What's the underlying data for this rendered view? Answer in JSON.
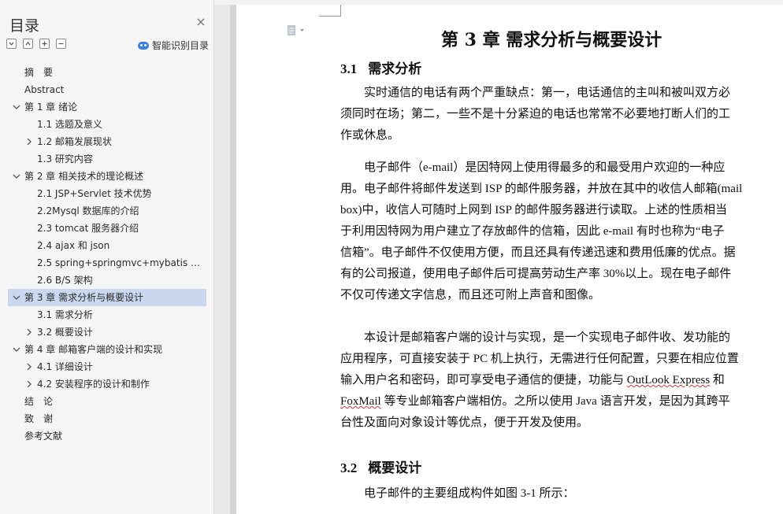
{
  "sidebar": {
    "title": "目录",
    "close": "×",
    "smart_toc_label": "智能识别目录",
    "items": [
      {
        "label": "摘　要",
        "level": 1,
        "arrow": "",
        "selected": false
      },
      {
        "label": "Abstract",
        "level": 1,
        "arrow": "",
        "selected": false
      },
      {
        "label": "第 1 章  绪论",
        "level": 1,
        "arrow": "down",
        "selected": false
      },
      {
        "label": "1.1  选题及意义",
        "level": 2,
        "arrow": "",
        "selected": false
      },
      {
        "label": "1.2  邮箱发展现状",
        "level": 2,
        "arrow": "right",
        "selected": false
      },
      {
        "label": "1.3 研究内容",
        "level": 2,
        "arrow": "",
        "selected": false
      },
      {
        "label": "第 2 章  相关技术的理论概述",
        "level": 1,
        "arrow": "down",
        "selected": false
      },
      {
        "label": "2.1 JSP+Servlet 技术优势",
        "level": 2,
        "arrow": "",
        "selected": false
      },
      {
        "label": "2.2Mysql 数据库的介绍",
        "level": 2,
        "arrow": "",
        "selected": false
      },
      {
        "label": "2.3 tomcat 服务器介绍",
        "level": 2,
        "arrow": "",
        "selected": false
      },
      {
        "label": "2.4 ajax 和 json",
        "level": 2,
        "arrow": "",
        "selected": false
      },
      {
        "label": "2.5 spring+springmvc+mybatis 框...",
        "level": 2,
        "arrow": "",
        "selected": false
      },
      {
        "label": "2.6 B/S 架构",
        "level": 2,
        "arrow": "",
        "selected": false
      },
      {
        "label": "第 3 章  需求分析与概要设计",
        "level": 1,
        "arrow": "down",
        "selected": true
      },
      {
        "label": "3.1  需求分析",
        "level": 2,
        "arrow": "",
        "selected": false
      },
      {
        "label": "3.2  概要设计",
        "level": 2,
        "arrow": "right",
        "selected": false
      },
      {
        "label": "第 4 章  邮箱客户端的设计和实现",
        "level": 1,
        "arrow": "down",
        "selected": false
      },
      {
        "label": "4.1  详细设计",
        "level": 2,
        "arrow": "right",
        "selected": false
      },
      {
        "label": "4.2  安装程序的设计和制作",
        "level": 2,
        "arrow": "right",
        "selected": false
      },
      {
        "label": "结　论",
        "level": 1,
        "arrow": "",
        "selected": false
      },
      {
        "label": "致　谢",
        "level": 1,
        "arrow": "",
        "selected": false
      },
      {
        "label": "参考文献",
        "level": 1,
        "arrow": "",
        "selected": false
      }
    ]
  },
  "document": {
    "chapter_title": "第 3 章  需求分析与概要设计",
    "section1": {
      "num": "3.1",
      "title": "需求分析"
    },
    "para1": [
      "　　实时通信的电话有两个严重缺点：第一，电话通信的主叫和被叫双方必",
      "须同时在场；第二，一些不是十分紧迫的电话也常常不必要地打断人们的工",
      "作或休息。"
    ],
    "para2": [
      "　　电子邮件（e-mail）是因特网上使用得最多的和最受用户欢迎的一种应",
      "用。电子邮件将邮件发送到 ISP 的邮件服务器，并放在其中的收信人邮箱(mail",
      "box)中，收信人可随时上网到 ISP 的邮件服务器进行读取。上述的性质相当",
      "于利用因特网为用户建立了存放邮件的信箱，因此 e-mail 有时也称为“电子",
      "信箱”。电子邮件不仅使用方便，而且还具有传递迅速和费用低廉的优点。据",
      "有的公司报道，使用电子邮件后可提高劳动生产率 30%以上。现在电子邮件",
      "不仅可传递文字信息，而且还可附上声音和图像。"
    ],
    "para3": [
      "　　本设计是邮箱客户端的设计与实现，是一个实现电子邮件收、发功能的",
      "应用程序，可直接安装于 PC 机上执行，无需进行任何配置，只要在相应位置",
      "输入用户名和密码，即可享受电子通信的便捷，功能与 ",
      "OutLook Express",
      " 和",
      "FoxMail",
      " 等专业邮箱客户端相仿。之所以使用 Java 语言开发，是因为其跨平",
      "台性及面向对象设计等优点，便于开发及使用。"
    ],
    "section2": {
      "num": "3.2",
      "title": "概要设计"
    },
    "para4": "　　电子邮件的主要组成构件如图 3-1 所示："
  }
}
